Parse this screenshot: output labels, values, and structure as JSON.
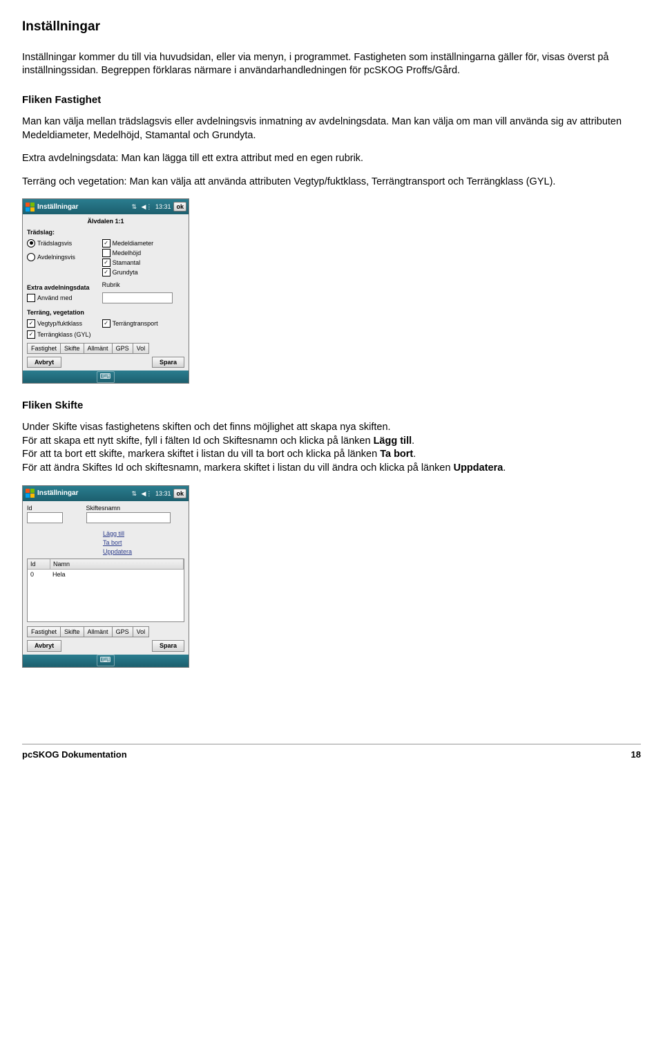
{
  "page": {
    "title": "Inställningar",
    "intro": "Inställningar kommer du till via huvudsidan, eller via menyn, i programmet. Fastigheten som inställningarna gäller för, visas överst på inställningssidan. Begreppen förklaras närmare i användarhandledningen för pcSKOG Proffs/Gård.",
    "section1_heading": "Fliken Fastighet",
    "section1_p1": "Man kan välja mellan trädslagsvis eller avdelningsvis inmatning av avdelningsdata. Man kan välja om man vill använda sig av attributen Medeldiameter, Medelhöjd, Stamantal och Grundyta.",
    "section1_p2": "Extra avdelningsdata: Man kan lägga till ett extra attribut med en egen rubrik.",
    "section1_p3": "Terräng och vegetation: Man kan välja att använda attributen Vegtyp/fuktklass, Terrängtransport och Terrängklass (GYL).",
    "section2_heading": "Fliken Skifte",
    "section2_p1a": "Under Skifte visas fastighetens skiften och det finns möjlighet att skapa nya skiften.",
    "section2_p1b_pre": "För att skapa ett nytt skifte, fyll i fälten Id och Skiftesnamn och klicka på länken ",
    "section2_p1b_bold": "Lägg till",
    "section2_p1c_pre": "För att ta bort ett skifte, markera skiftet i listan du vill ta bort och klicka på länken ",
    "section2_p1c_bold": "Ta bort",
    "section2_p1d_pre": "För att ändra Skiftes Id och skiftesnamn, markera skiftet i listan du vill ändra och klicka på länken ",
    "section2_p1d_bold": "Uppdatera"
  },
  "device1": {
    "title": "Inställningar",
    "time": "13:31",
    "ok": "ok",
    "subtitle": "Älvdalen 1:1",
    "tradslag_label": "Trädslag:",
    "radio1": "Trädslagsvis",
    "radio2": "Avdelningsvis",
    "chk1": "Medeldiameter",
    "chk2": "Medelhöjd",
    "chk3": "Stamantal",
    "chk4": "Grundyta",
    "extra_label": "Extra avdelningsdata",
    "rubrik_label": "Rubrik",
    "anvand_med": "Använd med",
    "terrang_label": "Terräng, vegetation",
    "veg1": "Vegtyp/fuktklass",
    "veg2": "Terrängtransport",
    "veg3": "Terrängklass (GYL)",
    "tabs": [
      "Fastighet",
      "Skifte",
      "Allmänt",
      "GPS",
      "Vol"
    ],
    "avbryt": "Avbryt",
    "spara": "Spara"
  },
  "device2": {
    "title": "Inställningar",
    "time": "13:31",
    "ok": "ok",
    "id_label": "Id",
    "name_label": "Skiftesnamn",
    "link1": "Lägg till",
    "link2": "Ta bort",
    "link3": "Uppdatera",
    "col_id": "Id",
    "col_name": "Namn",
    "row_id": "0",
    "row_name": "Hela",
    "tabs": [
      "Fastighet",
      "Skifte",
      "Allmänt",
      "GPS",
      "Vol"
    ],
    "avbryt": "Avbryt",
    "spara": "Spara"
  },
  "footer": {
    "left": "pcSKOG Dokumentation",
    "right": "18"
  }
}
